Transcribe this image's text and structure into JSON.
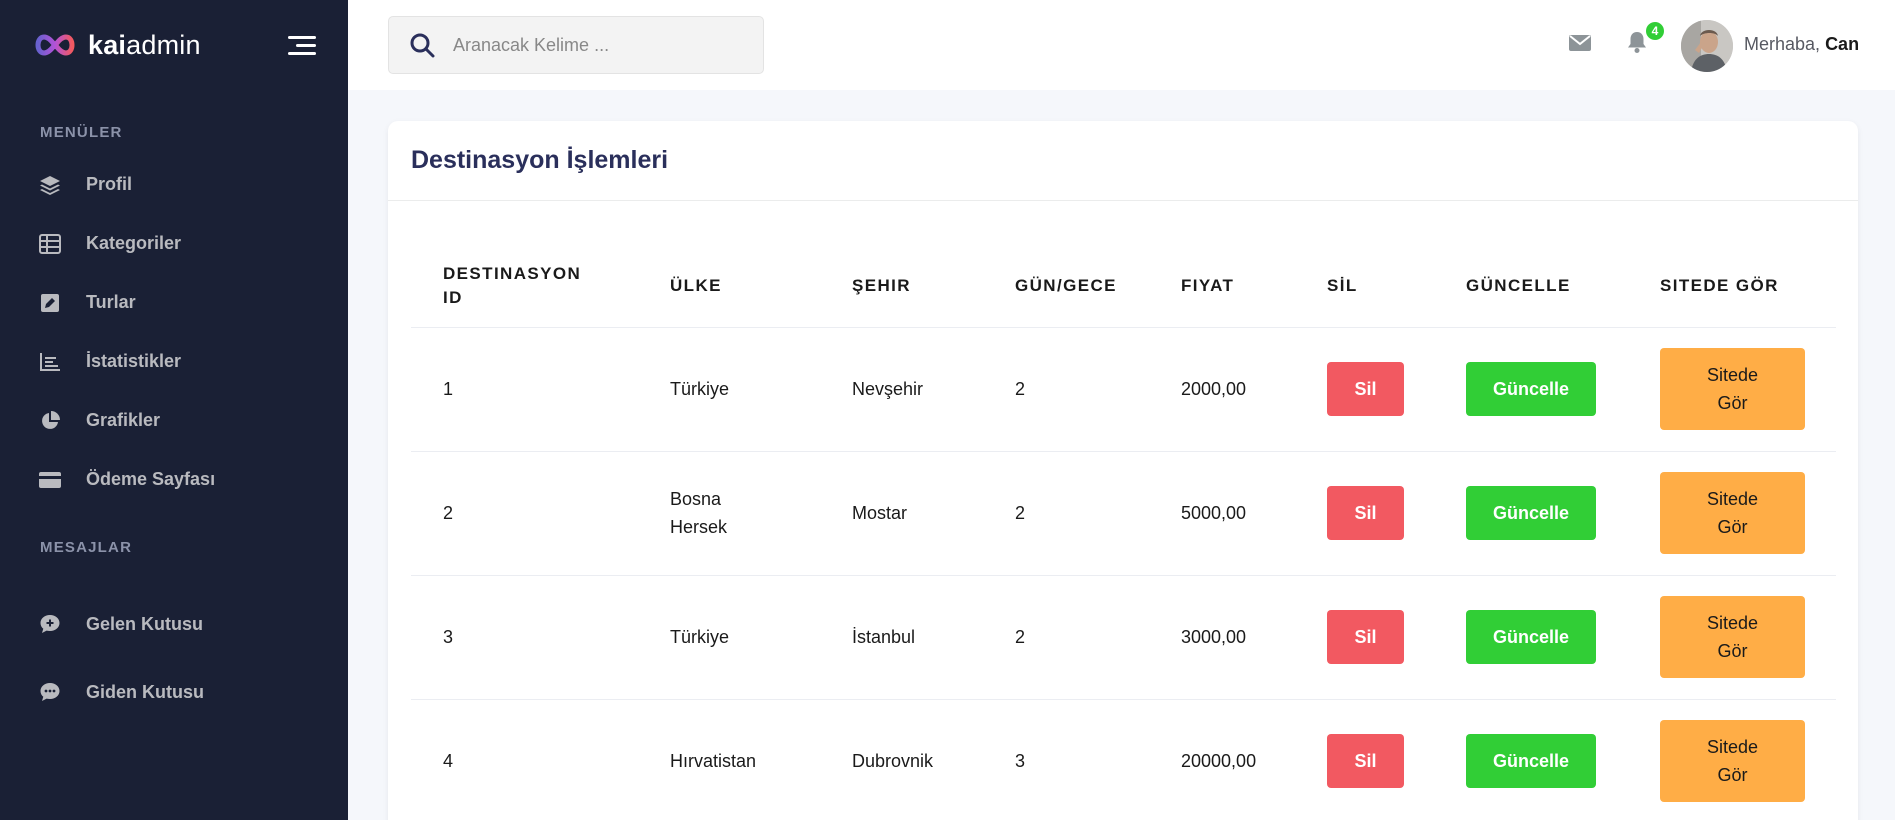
{
  "brand": {
    "bold": "kai",
    "light": "admin"
  },
  "sidebar": {
    "sections": [
      {
        "title": "MENÜLER"
      },
      {
        "title": "MESAJLAR"
      }
    ],
    "menu_items": [
      {
        "label": "Profil",
        "icon": "layers-icon"
      },
      {
        "label": "Kategoriler",
        "icon": "table-icon"
      },
      {
        "label": "Turlar",
        "icon": "edit-square-icon"
      },
      {
        "label": "İstatistikler",
        "icon": "bar-chart-icon"
      },
      {
        "label": "Grafikler",
        "icon": "pie-chart-icon"
      },
      {
        "label": "Ödeme Sayfası",
        "icon": "credit-card-icon"
      }
    ],
    "message_items": [
      {
        "label": "Gelen Kutusu",
        "icon": "chat-plus-icon"
      },
      {
        "label": "Giden Kutusu",
        "icon": "chat-dots-icon"
      }
    ]
  },
  "header": {
    "search_placeholder": "Aranacak Kelime ...",
    "notification_count": "4",
    "greeting": "Merhaba,",
    "user_name": "Can"
  },
  "card": {
    "title": "Destinasyon İşlemleri"
  },
  "table": {
    "columns": [
      "DESTINASYON ID",
      "ÜLKE",
      "ŞEHIR",
      "GÜN/GECE",
      "FIYAT",
      "SİL",
      "GÜNCELLE",
      "SITEDE GÖR"
    ],
    "rows": [
      {
        "id": "1",
        "country": "Türkiye",
        "city": "Nevşehir",
        "days": "2",
        "price": "2000,00"
      },
      {
        "id": "2",
        "country": "Bosna Hersek",
        "city": "Mostar",
        "days": "2",
        "price": "5000,00"
      },
      {
        "id": "3",
        "country": "Türkiye",
        "city": "İstanbul",
        "days": "2",
        "price": "3000,00"
      },
      {
        "id": "4",
        "country": "Hırvatistan",
        "city": "Dubrovnik",
        "days": "3",
        "price": "20000,00"
      }
    ],
    "buttons": {
      "delete": "Sil",
      "update": "Güncelle",
      "view": "Sitede Gör"
    }
  },
  "colors": {
    "sidebar_bg": "#1a2035",
    "delete": "#f25961",
    "update": "#31ce36",
    "view": "#ffad46",
    "badge": "#31ce36"
  }
}
